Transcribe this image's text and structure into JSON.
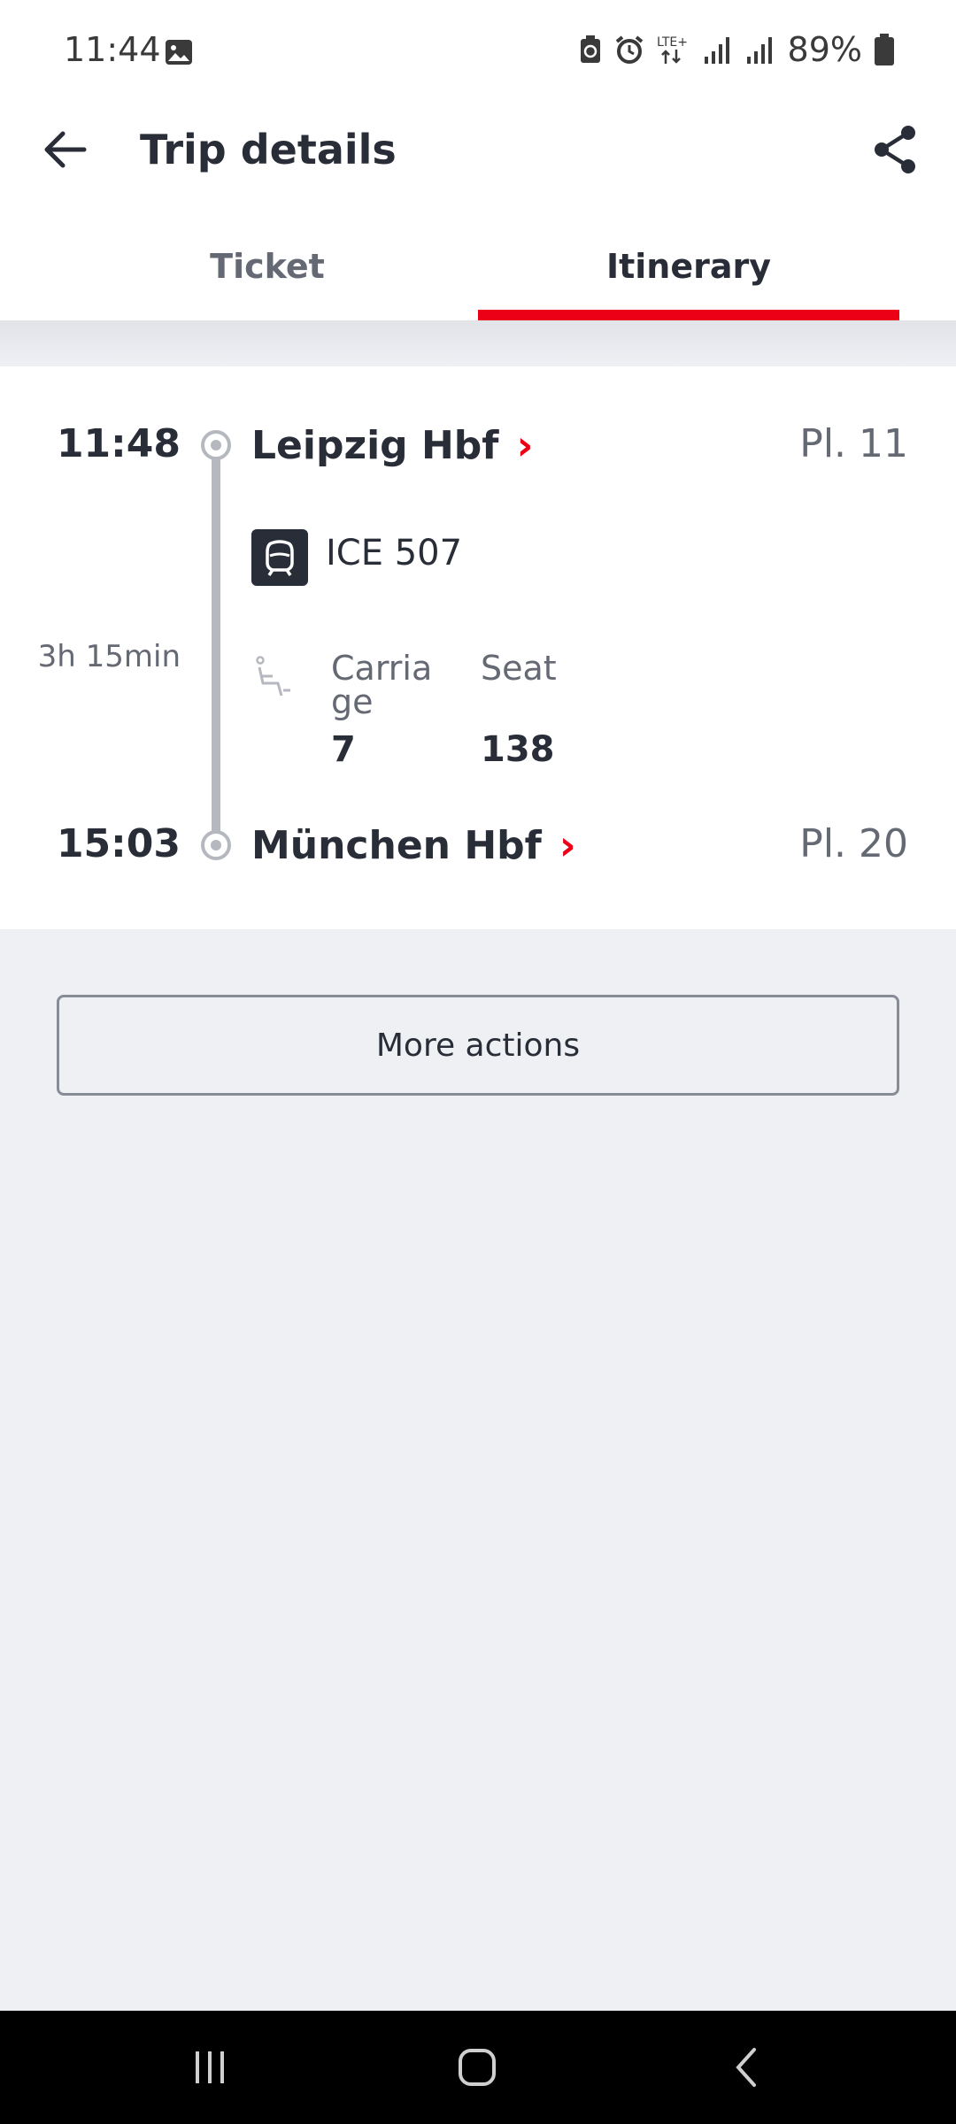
{
  "status_bar": {
    "time": "11:44",
    "battery_percent": "89%",
    "icons": [
      "image-icon",
      "battery-saver-icon",
      "alarm-icon",
      "lte-icon",
      "signal-icon",
      "signal-icon",
      "battery-icon"
    ],
    "lte_label": "LTE+"
  },
  "header": {
    "title": "Trip details",
    "back_icon": "arrow-left-icon",
    "share_icon": "share-icon"
  },
  "tabs": [
    {
      "label": "Ticket",
      "selected": false
    },
    {
      "label": "Itinerary",
      "selected": true
    }
  ],
  "itinerary": {
    "departure": {
      "time": "11:48",
      "station": "Leipzig Hbf",
      "platform": "Pl. 11"
    },
    "arrival": {
      "time": "15:03",
      "station": "München Hbf",
      "platform": "Pl. 20"
    },
    "duration": "3h 15min",
    "train": {
      "name": "ICE 507",
      "icon": "train-icon"
    },
    "reservation": {
      "carriage_label": "Carriage",
      "carriage_value": "7",
      "seat_label": "Seat",
      "seat_value": "138",
      "icon": "seat-icon"
    }
  },
  "actions": {
    "more_actions_label": "More actions"
  },
  "colors": {
    "accent": "#ec0016",
    "text": "#282d37",
    "muted": "#646973",
    "background": "#eff0f4"
  }
}
